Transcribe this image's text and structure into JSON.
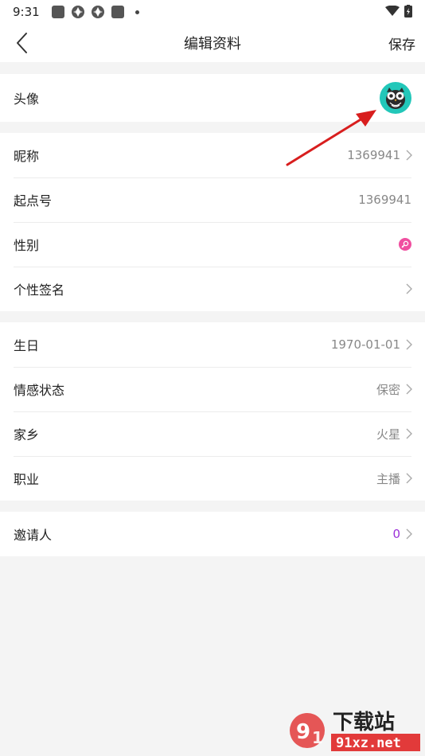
{
  "status_bar": {
    "time": "9:31"
  },
  "header": {
    "title": "编辑资料",
    "save_label": "保存"
  },
  "rows": {
    "avatar": {
      "label": "头像"
    },
    "nickname": {
      "label": "昵称",
      "value": "1369941"
    },
    "qidian_id": {
      "label": "起点号",
      "value": "1369941"
    },
    "gender": {
      "label": "性别"
    },
    "signature": {
      "label": "个性签名",
      "value": ""
    },
    "birthday": {
      "label": "生日",
      "value": "1970-01-01"
    },
    "relationship": {
      "label": "情感状态",
      "value": "保密"
    },
    "hometown": {
      "label": "家乡",
      "value": "火星"
    },
    "occupation": {
      "label": "职业",
      "value": "主播"
    },
    "inviter": {
      "label": "邀请人",
      "value": "0"
    }
  },
  "colors": {
    "accent_invite": "#9b30d8",
    "avatar_bg": "#22c7b9",
    "gender_female": "#f04fa0",
    "annotation_arrow": "#d81e1e"
  },
  "watermark": {
    "top": "下载站",
    "bottom": "91xz.net"
  }
}
